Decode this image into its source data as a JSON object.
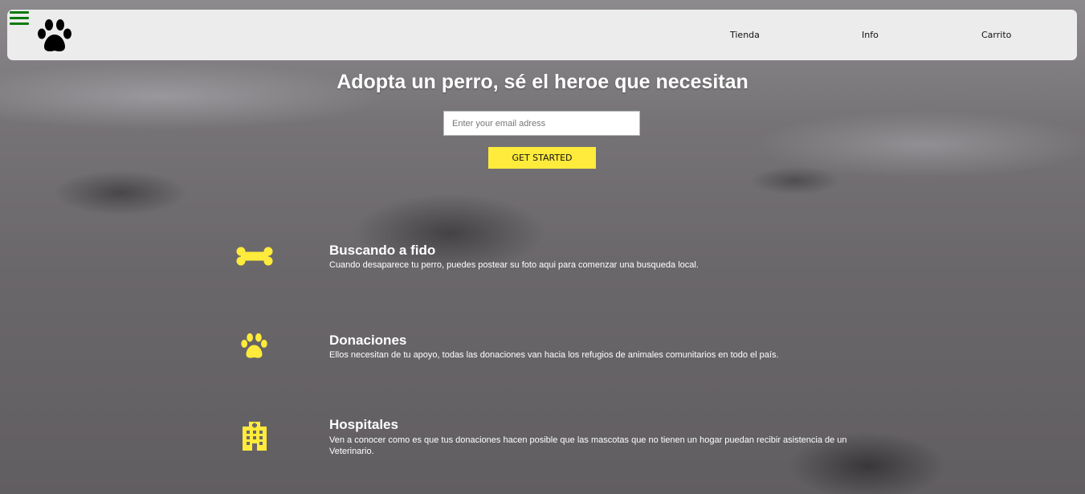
{
  "nav": {
    "links": [
      "Tienda",
      "Info",
      "Carrito"
    ]
  },
  "hero": {
    "title": "Adopta un perro, sé el heroe que necesitan",
    "email_placeholder": "Enter your email adress",
    "cta_label": "GET STARTED"
  },
  "features": [
    {
      "icon": "bone-icon",
      "title": "Buscando a fido",
      "description": "Cuando desaparece tu perro, puedes postear su foto aqui para comenzar una busqueda local."
    },
    {
      "icon": "paw-icon",
      "title": "Donaciones",
      "description": "Ellos necesitan de tu apoyo, todas las donaciones van hacia los refugios de animales comunitarios en todo el país."
    },
    {
      "icon": "hospital-icon",
      "title": "Hospitales",
      "description": "Ven a conocer como es que tus donaciones hacen posible que las mascotas que no tienen un hogar puedan recibir asistencia de un Veterinario."
    }
  ],
  "colors": {
    "accent": "#ffeb3b",
    "menu": "#0b7a0b",
    "navbar_bg": "#ececec"
  }
}
